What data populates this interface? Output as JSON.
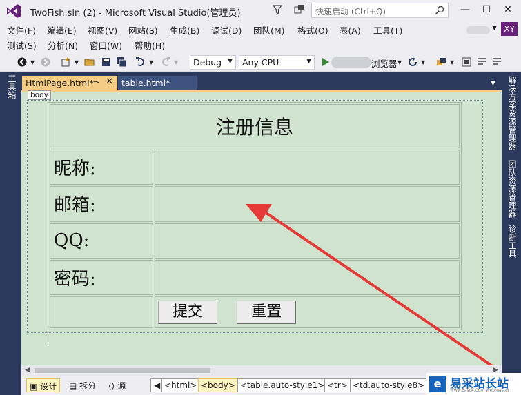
{
  "window": {
    "title": "TwoFish.sln (2) - Microsoft Visual Studio(管理员)",
    "quick_launch_placeholder": "快速启动 (Ctrl+Q)",
    "minimize": "—",
    "maximize": "☐",
    "close": "✕"
  },
  "menu": {
    "row1": [
      "文件(F)",
      "编辑(E)",
      "视图(V)",
      "网站(S)",
      "生成(B)",
      "调试(D)",
      "团队(M)",
      "格式(O)",
      "表(A)",
      "工具(T)"
    ],
    "row2": [
      "测试(S)",
      "分析(N)",
      "窗口(W)",
      "帮助(H)"
    ],
    "avatar": "XY"
  },
  "toolbar": {
    "config": "Debug",
    "platform": "Any CPU",
    "browser": "浏览器"
  },
  "side_panels": {
    "left": "工具箱",
    "right": [
      "解决方案资源管理器",
      "团队资源管理器",
      "诊断工具"
    ]
  },
  "tabs": {
    "active": "HtmlPage.html*",
    "inactive": "table.html*",
    "pin": "⊸",
    "close": "✕"
  },
  "design": {
    "body_tag": "body",
    "table": {
      "title": "注册信息",
      "rows": [
        {
          "label": "昵称:"
        },
        {
          "label": "邮箱:"
        },
        {
          "label": "QQ:"
        },
        {
          "label": "密码:"
        }
      ],
      "submit": "提交",
      "reset": "重置"
    }
  },
  "bottom": {
    "views": [
      "设计",
      "拆分",
      "源"
    ],
    "breadcrumbs": [
      "<html>",
      "<body>",
      "<table.auto-style1>",
      "<tr>",
      "<td.auto-style8>"
    ],
    "watermark": "易采站长站",
    "watermark_sub": "Www.Easck.Com Webmaster"
  },
  "colors": {
    "accent_purple": "#68217a",
    "panel_navy": "#2b3a5c",
    "tab_active": "#f5cc84",
    "design_bg": "#cfe3ce",
    "arrow_red": "#e53935"
  }
}
